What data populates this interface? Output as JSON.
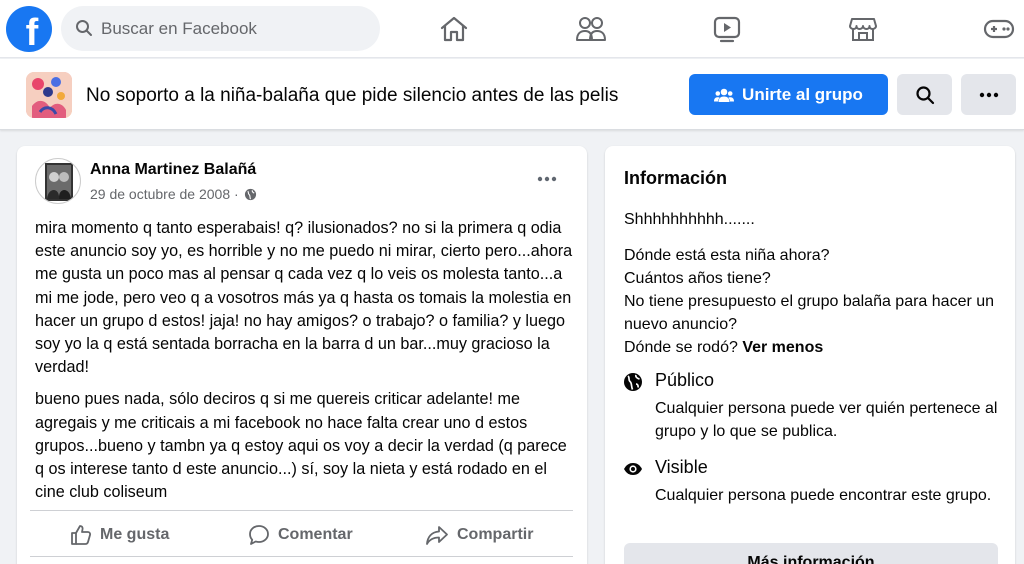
{
  "topbar": {
    "logo_letter": "f",
    "search": {
      "placeholder": "Buscar en Facebook"
    },
    "nav_icons": [
      "home-icon",
      "people-icon",
      "video-icon",
      "marketplace-icon",
      "gaming-icon"
    ]
  },
  "group": {
    "name": "No soporto a la niña-balaña que pide silencio antes de las pelis",
    "join_label": "Unirte al grupo"
  },
  "post": {
    "author": "Anna Martinez Balañá",
    "date": "29 de octubre de 2008 ·",
    "paragraph1": "mira momento q tanto esperabais! q? ilusionados? no si la primera q odia este anuncio soy yo, es horrible y no me puedo ni mirar, cierto pero...ahora me gusta un poco mas al pensar q cada vez q lo veis os molesta tanto...a mi me jode, pero veo q a vosotros más ya q hasta os tomais la molestia en hacer un grupo d estos! jaja! no hay amigos? o trabajo? o familia? y luego soy yo la q está sentada borracha en la barra d un bar...muy gracioso la verdad!",
    "paragraph2": "bueno pues nada, sólo deciros q si me quereis criticar adelante! me agregais y me criticais a mi facebook no hace falta crear uno d estos grupos...bueno y tambn ya q estoy aqui os voy a decir la verdad (q parece q os interese tanto d este anuncio...) sí, soy la nieta y está rodado en el cine club coliseum",
    "actions": {
      "like": "Me gusta",
      "comment": "Comentar",
      "share": "Compartir"
    }
  },
  "info": {
    "title": "Información",
    "desc_lines": [
      "Shhhhhhhhhh.......",
      "Dónde está esta niña ahora?",
      "Cuántos años tiene?",
      "No tiene presupuesto el grupo balaña para hacer un nuevo anuncio?",
      "Dónde se rodó?"
    ],
    "see_less": "Ver menos",
    "privacy": {
      "title": "Público",
      "desc": "Cualquier persona puede ver quién pertenece al grupo y lo que se publica."
    },
    "visibility": {
      "title": "Visible",
      "desc": "Cualquier persona puede encontrar este grupo."
    },
    "more_label": "Más información"
  },
  "colors": {
    "brand": "#1877f2",
    "background": "#f0f2f5",
    "secondary_text": "#65676b"
  }
}
